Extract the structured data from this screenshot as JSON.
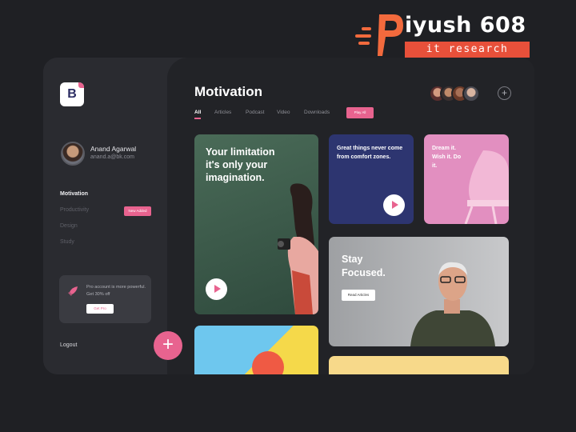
{
  "watermark": {
    "name": "iyush 608",
    "tagline": "it research"
  },
  "sidebar": {
    "logo_letter": "B",
    "user": {
      "name": "Anand Agarwal",
      "email": "anand.a@bk.com"
    },
    "nav": [
      {
        "label": "Motivation",
        "active": true
      },
      {
        "label": "Productivity",
        "active": false
      },
      {
        "label": "Design",
        "active": false
      },
      {
        "label": "Study",
        "active": false
      }
    ],
    "new_badge": "New Added",
    "promo": {
      "text": "Pro account is more powerful. Get 30% off",
      "button": "Get Pro"
    },
    "logout": "Logout",
    "fab_symbol": "+"
  },
  "main": {
    "title": "Motivation",
    "tabs": [
      {
        "label": "All",
        "active": true
      },
      {
        "label": "Articles",
        "active": false
      },
      {
        "label": "Podcast",
        "active": false
      },
      {
        "label": "Video",
        "active": false
      },
      {
        "label": "Downloads",
        "active": false
      }
    ],
    "play_all": "Play All",
    "add_symbol": "+",
    "cards": {
      "quote1": "Your limitation it's only your imagination.",
      "quote2": "Great things never come from comfort zones.",
      "quote3": "Dream it. Wish it. Do it.",
      "focus_title": "Stay Focused.",
      "focus_button": "Read Articles"
    }
  },
  "colors": {
    "accent": "#e8638f",
    "navy_card": "#2d3570",
    "pink_card": "#e28fc0"
  }
}
